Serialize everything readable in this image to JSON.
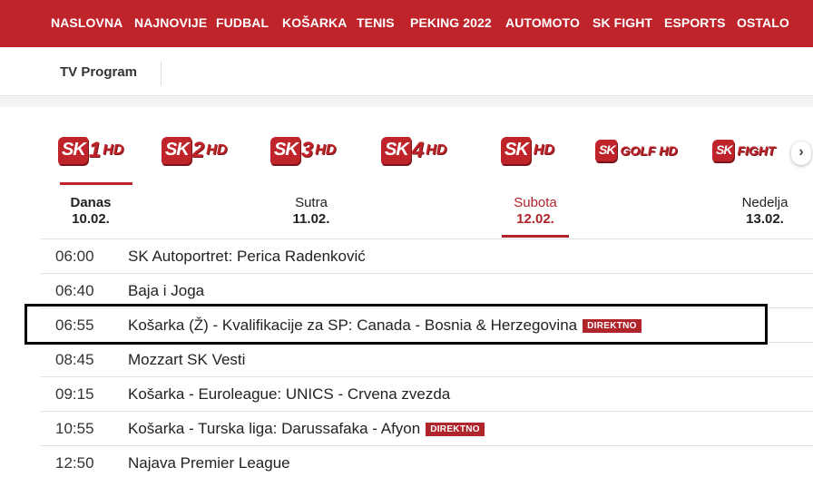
{
  "topnav": {
    "items": [
      "NASLOVNA",
      "NAJNOVIJE",
      "FUDBAL",
      "KOŠARKA",
      "TENIS",
      "PEKING 2022",
      "AUTOMOTO",
      "SK FIGHT",
      "ESPORTS",
      "OSTALO"
    ]
  },
  "subnav": {
    "tv_program": "TV Program"
  },
  "channels": [
    {
      "sk": "SK",
      "num": "1",
      "suffix": "HD"
    },
    {
      "sk": "SK",
      "num": "2",
      "suffix": "HD"
    },
    {
      "sk": "SK",
      "num": "3",
      "suffix": "HD"
    },
    {
      "sk": "SK",
      "num": "4",
      "suffix": "HD"
    },
    {
      "sk": "SK",
      "num": "",
      "suffix": "HD"
    },
    {
      "sk": "SK",
      "num": "",
      "suffix": "GOLF HD"
    },
    {
      "sk": "SK",
      "num": "",
      "suffix": "FIGHT"
    }
  ],
  "next_arrow": "›",
  "days": [
    {
      "name": "Danas",
      "date": "10.02."
    },
    {
      "name": "Sutra",
      "date": "11.02."
    },
    {
      "name": "Subota",
      "date": "12.02."
    },
    {
      "name": "Nedelja",
      "date": "13.02."
    }
  ],
  "active_day": "Subota",
  "schedule": [
    {
      "time": "06:00",
      "title": "SK Autoportret: Perica Radenković",
      "badge": ""
    },
    {
      "time": "06:40",
      "title": "Baja i Joga",
      "badge": ""
    },
    {
      "time": "06:55",
      "title": "Košarka (Ž) - Kvalifikacije za SP: Canada - Bosnia & Herzegovina",
      "badge": "DIREKTNO"
    },
    {
      "time": "08:45",
      "title": "Mozzart SK Vesti",
      "badge": ""
    },
    {
      "time": "09:15",
      "title": "Košarka - Euroleague: UNICS - Crvena zvezda",
      "badge": ""
    },
    {
      "time": "10:55",
      "title": "Košarka - Turska liga: Darussafaka - Afyon",
      "badge": "DIREKTNO"
    },
    {
      "time": "12:50",
      "title": "Najava Premier League",
      "badge": ""
    }
  ],
  "colors": {
    "brand_red": "#c0242b",
    "active_red": "#b0242b",
    "highlight_border": "#000000"
  }
}
